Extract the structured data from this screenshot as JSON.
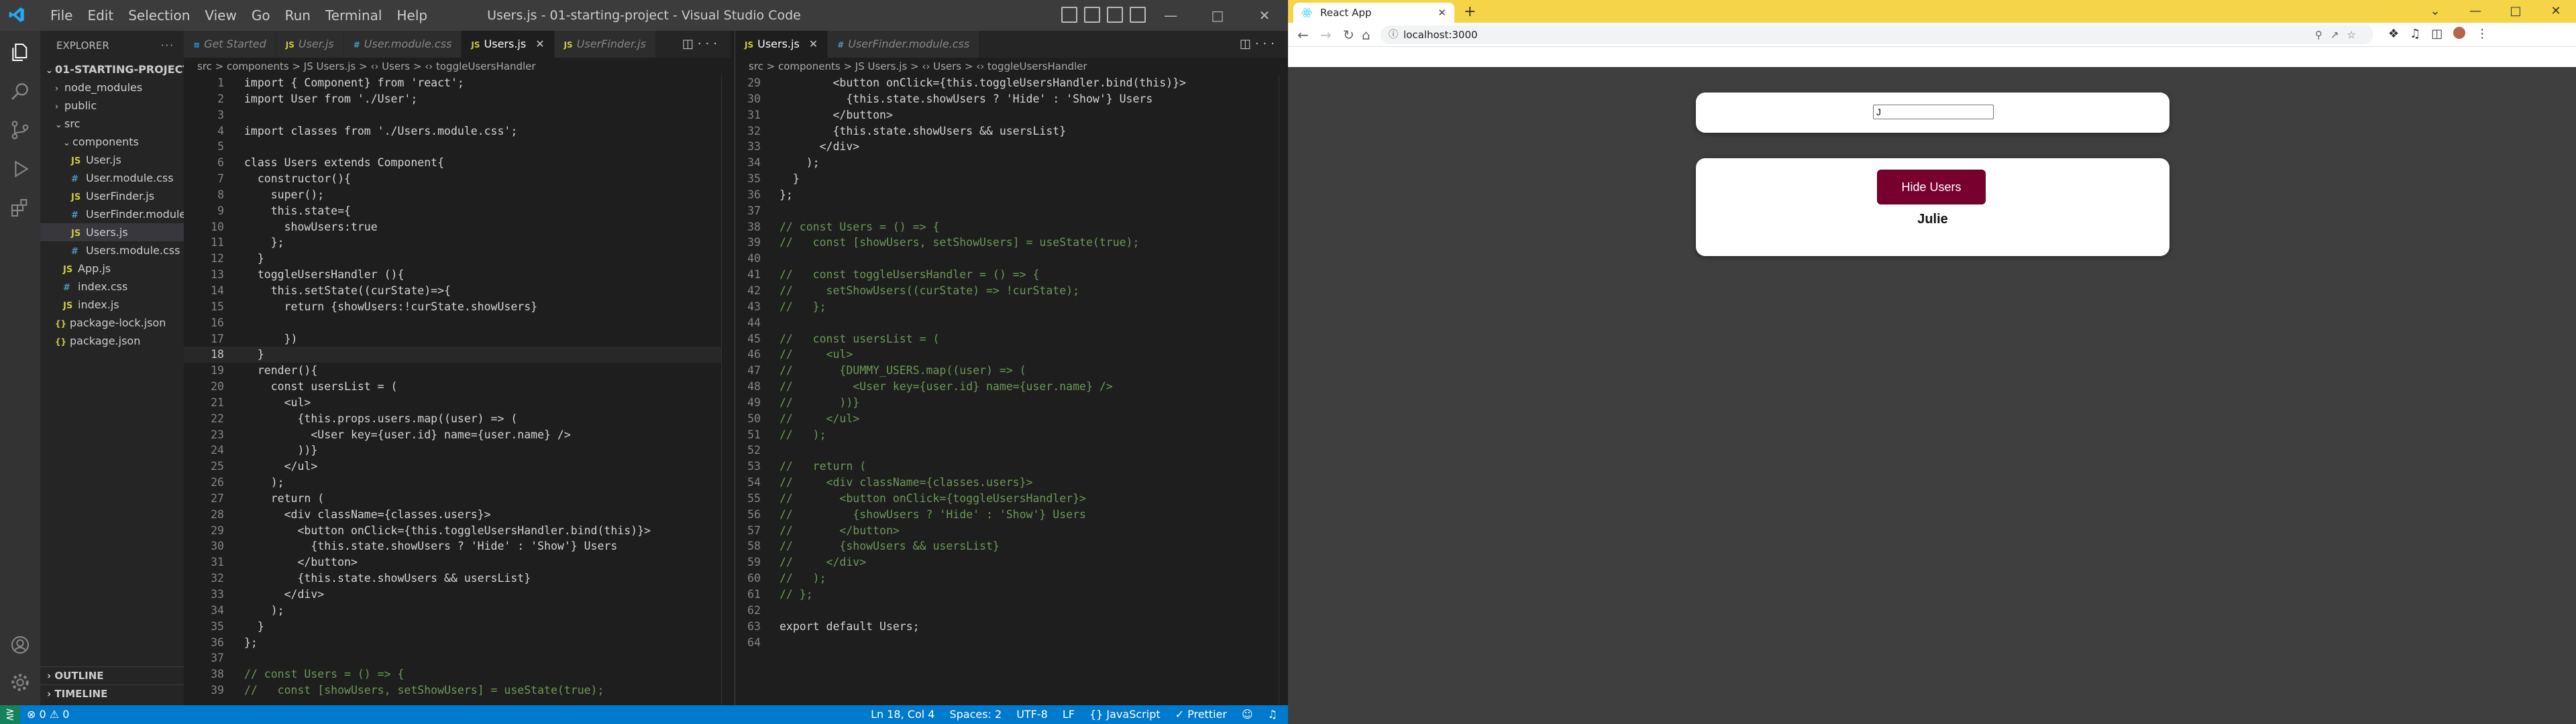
{
  "vscode": {
    "window_title": "Users.js - 01-starting-project - Visual Studio Code",
    "menu": [
      "File",
      "Edit",
      "Selection",
      "View",
      "Go",
      "Run",
      "Terminal",
      "Help"
    ],
    "sidebar": {
      "header": "EXPLORER",
      "root": "01-STARTING-PROJECT",
      "items": [
        {
          "label": "node_modules",
          "kind": "folder",
          "depth": 1
        },
        {
          "label": "public",
          "kind": "folder",
          "depth": 1
        },
        {
          "label": "src",
          "kind": "folder",
          "depth": 1,
          "open": true
        },
        {
          "label": "components",
          "kind": "folder",
          "depth": 2,
          "open": true
        },
        {
          "label": "User.js",
          "kind": "js",
          "depth": 3
        },
        {
          "label": "User.module.css",
          "kind": "css",
          "depth": 3
        },
        {
          "label": "UserFinder.js",
          "kind": "js",
          "depth": 3
        },
        {
          "label": "UserFinder.module...",
          "kind": "css",
          "depth": 3
        },
        {
          "label": "Users.js",
          "kind": "js",
          "depth": 3,
          "selected": true
        },
        {
          "label": "Users.module.css",
          "kind": "css",
          "depth": 3
        },
        {
          "label": "App.js",
          "kind": "js",
          "depth": 2
        },
        {
          "label": "index.css",
          "kind": "css",
          "depth": 2
        },
        {
          "label": "index.js",
          "kind": "js",
          "depth": 2
        },
        {
          "label": "package-lock.json",
          "kind": "json",
          "depth": 1
        },
        {
          "label": "package.json",
          "kind": "json",
          "depth": 1
        }
      ],
      "outline": "OUTLINE",
      "timeline": "TIMELINE"
    },
    "pane1": {
      "tabs": [
        {
          "label": "Get Started",
          "icon": "vs",
          "active": false
        },
        {
          "label": "User.js",
          "icon": "JS",
          "active": false
        },
        {
          "label": "User.module.css",
          "icon": "#",
          "active": false
        },
        {
          "label": "Users.js",
          "icon": "JS",
          "active": true
        },
        {
          "label": "UserFinder.js",
          "icon": "JS",
          "active": false
        }
      ],
      "breadcrumb": "src > components > JS Users.js > ‹› Users > ‹› toggleUsersHandler",
      "cursor_line": 18,
      "lines": [
        {
          "n": 1,
          "t": "import { Component} from 'react';"
        },
        {
          "n": 2,
          "t": "import User from './User';"
        },
        {
          "n": 3,
          "t": ""
        },
        {
          "n": 4,
          "t": "import classes from './Users.module.css';"
        },
        {
          "n": 5,
          "t": ""
        },
        {
          "n": 6,
          "t": "class Users extends Component{"
        },
        {
          "n": 7,
          "t": "  constructor(){"
        },
        {
          "n": 8,
          "t": "    super();"
        },
        {
          "n": 9,
          "t": "    this.state={"
        },
        {
          "n": 10,
          "t": "      showUsers:true"
        },
        {
          "n": 11,
          "t": "    };"
        },
        {
          "n": 12,
          "t": "  }"
        },
        {
          "n": 13,
          "t": "  toggleUsersHandler (){"
        },
        {
          "n": 14,
          "t": "    this.setState((curState)=>{"
        },
        {
          "n": 15,
          "t": "      return {showUsers:!curState.showUsers}"
        },
        {
          "n": 16,
          "t": ""
        },
        {
          "n": 17,
          "t": "      })"
        },
        {
          "n": 18,
          "t": "  }"
        },
        {
          "n": 19,
          "t": "  render(){"
        },
        {
          "n": 20,
          "t": "    const usersList = ("
        },
        {
          "n": 21,
          "t": "      <ul>"
        },
        {
          "n": 22,
          "t": "        {this.props.users.map((user) => ("
        },
        {
          "n": 23,
          "t": "          <User key={user.id} name={user.name} />"
        },
        {
          "n": 24,
          "t": "        ))}"
        },
        {
          "n": 25,
          "t": "      </ul>"
        },
        {
          "n": 26,
          "t": "    );"
        },
        {
          "n": 27,
          "t": "    return ("
        },
        {
          "n": 28,
          "t": "      <div className={classes.users}>"
        },
        {
          "n": 29,
          "t": "        <button onClick={this.toggleUsersHandler.bind(this)}>"
        },
        {
          "n": 30,
          "t": "          {this.state.showUsers ? 'Hide' : 'Show'} Users"
        },
        {
          "n": 31,
          "t": "        </button>"
        },
        {
          "n": 32,
          "t": "        {this.state.showUsers && usersList}"
        },
        {
          "n": 33,
          "t": "      </div>"
        },
        {
          "n": 34,
          "t": "    );"
        },
        {
          "n": 35,
          "t": "  }"
        },
        {
          "n": 36,
          "t": "};"
        },
        {
          "n": 37,
          "t": ""
        },
        {
          "n": 38,
          "t": "// const Users = () => {"
        },
        {
          "n": 39,
          "t": "//   const [showUsers, setShowUsers] = useState(true);"
        }
      ]
    },
    "pane2": {
      "tabs": [
        {
          "label": "Users.js",
          "icon": "JS",
          "active": true
        },
        {
          "label": "UserFinder.module.css",
          "icon": "#",
          "active": false
        }
      ],
      "breadcrumb": "src > components > JS Users.js > ‹› Users > ‹› toggleUsersHandler",
      "lines": [
        {
          "n": 29,
          "t": "        <button onClick={this.toggleUsersHandler.bind(this)}>"
        },
        {
          "n": 30,
          "t": "          {this.state.showUsers ? 'Hide' : 'Show'} Users"
        },
        {
          "n": 31,
          "t": "        </button>"
        },
        {
          "n": 32,
          "t": "        {this.state.showUsers && usersList}"
        },
        {
          "n": 33,
          "t": "      </div>"
        },
        {
          "n": 34,
          "t": "    );"
        },
        {
          "n": 35,
          "t": "  }"
        },
        {
          "n": 36,
          "t": "};"
        },
        {
          "n": 37,
          "t": ""
        },
        {
          "n": 38,
          "t": "// const Users = () => {"
        },
        {
          "n": 39,
          "t": "//   const [showUsers, setShowUsers] = useState(true);"
        },
        {
          "n": 40,
          "t": ""
        },
        {
          "n": 41,
          "t": "//   const toggleUsersHandler = () => {"
        },
        {
          "n": 42,
          "t": "//     setShowUsers((curState) => !curState);"
        },
        {
          "n": 43,
          "t": "//   };"
        },
        {
          "n": 44,
          "t": ""
        },
        {
          "n": 45,
          "t": "//   const usersList = ("
        },
        {
          "n": 46,
          "t": "//     <ul>"
        },
        {
          "n": 47,
          "t": "//       {DUMMY_USERS.map((user) => ("
        },
        {
          "n": 48,
          "t": "//         <User key={user.id} name={user.name} />"
        },
        {
          "n": 49,
          "t": "//       ))}"
        },
        {
          "n": 50,
          "t": "//     </ul>"
        },
        {
          "n": 51,
          "t": "//   );"
        },
        {
          "n": 52,
          "t": ""
        },
        {
          "n": 53,
          "t": "//   return ("
        },
        {
          "n": 54,
          "t": "//     <div className={classes.users}>"
        },
        {
          "n": 55,
          "t": "//       <button onClick={toggleUsersHandler}>"
        },
        {
          "n": 56,
          "t": "//         {showUsers ? 'Hide' : 'Show'} Users"
        },
        {
          "n": 57,
          "t": "//       </button>"
        },
        {
          "n": 58,
          "t": "//       {showUsers && usersList}"
        },
        {
          "n": 59,
          "t": "//     </div>"
        },
        {
          "n": 60,
          "t": "//   );"
        },
        {
          "n": 61,
          "t": "// };"
        },
        {
          "n": 62,
          "t": ""
        },
        {
          "n": 63,
          "t": "export default Users;"
        },
        {
          "n": 64,
          "t": ""
        }
      ]
    },
    "statusbar": {
      "problems": "⊗ 0 ⚠ 0",
      "position": "Ln 18, Col 4",
      "spaces": "Spaces: 2",
      "encoding": "UTF-8",
      "eol": "LF",
      "language": "{} JavaScript",
      "prettier": "✓ Prettier"
    }
  },
  "browser": {
    "tab_title": "React App",
    "url": "localhost:3000",
    "filter_value": "J",
    "toggle_button": "Hide Users",
    "users": [
      "Julie"
    ],
    "accent": "#77002e"
  }
}
